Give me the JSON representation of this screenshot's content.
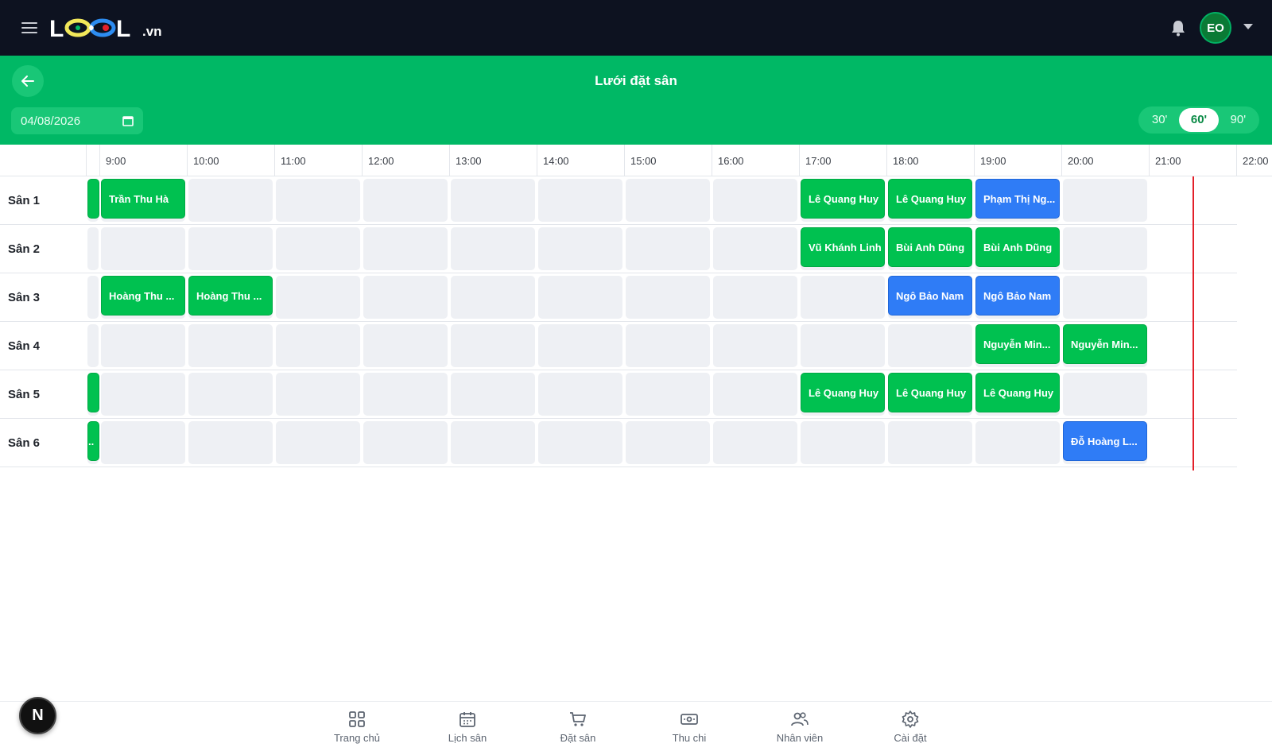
{
  "app": {
    "logo_text": "LOOL",
    "logo_suffix": ".vn",
    "user_initials": "EO",
    "page_title": "Lưới đặt sân",
    "date_value": "04/08/2026"
  },
  "colors": {
    "topbar": "#0d1220",
    "header_green": "#00b865",
    "booking_green": "#00c150",
    "booking_blue": "#2f7cf6",
    "now_line": "#e3202a"
  },
  "durations": [
    {
      "label": "30'",
      "active": false
    },
    {
      "label": "60'",
      "active": true
    },
    {
      "label": "90'",
      "active": false
    }
  ],
  "times": [
    "9:00",
    "10:00",
    "11:00",
    "12:00",
    "13:00",
    "14:00",
    "15:00",
    "16:00",
    "17:00",
    "18:00",
    "19:00",
    "20:00",
    "21:00",
    "22:00"
  ],
  "courts": [
    {
      "name": "Sân 1",
      "bookings": [
        {
          "slot": "8:00",
          "label": "",
          "color": "green",
          "partial": true
        },
        {
          "slot": "9:00",
          "label": "Trần Thu Hà",
          "color": "green"
        },
        {
          "slot": "17:00",
          "label": "Lê Quang Huy",
          "color": "green"
        },
        {
          "slot": "18:00",
          "label": "Lê Quang Huy",
          "color": "green"
        },
        {
          "slot": "19:00",
          "label": "Phạm Thị Ng...",
          "color": "blue"
        }
      ]
    },
    {
      "name": "Sân 2",
      "bookings": [
        {
          "slot": "17:00",
          "label": "Vũ Khánh Linh",
          "color": "green"
        },
        {
          "slot": "18:00",
          "label": "Bùi Anh Dũng",
          "color": "green"
        },
        {
          "slot": "19:00",
          "label": "Bùi Anh Dũng",
          "color": "green"
        }
      ]
    },
    {
      "name": "Sân 3",
      "bookings": [
        {
          "slot": "9:00",
          "label": "Hoàng Thu ...",
          "color": "green"
        },
        {
          "slot": "10:00",
          "label": "Hoàng Thu ...",
          "color": "green"
        },
        {
          "slot": "18:00",
          "label": "Ngô Bảo Nam",
          "color": "blue"
        },
        {
          "slot": "19:00",
          "label": "Ngô Bảo Nam",
          "color": "blue"
        }
      ]
    },
    {
      "name": "Sân 4",
      "bookings": [
        {
          "slot": "19:00",
          "label": "Nguyễn Min...",
          "color": "green"
        },
        {
          "slot": "20:00",
          "label": "Nguyễn Min...",
          "color": "green"
        }
      ]
    },
    {
      "name": "Sân 5",
      "bookings": [
        {
          "slot": "8:00",
          "label": "",
          "color": "green",
          "partial": true
        },
        {
          "slot": "17:00",
          "label": "Lê Quang Huy",
          "color": "green"
        },
        {
          "slot": "18:00",
          "label": "Lê Quang Huy",
          "color": "green"
        },
        {
          "slot": "19:00",
          "label": "Lê Quang Huy",
          "color": "green"
        }
      ]
    },
    {
      "name": "Sân 6",
      "bookings": [
        {
          "slot": "8:00",
          "label": "..",
          "color": "green",
          "partial": true
        },
        {
          "slot": "20:00",
          "label": "Đỗ Hoàng L...",
          "color": "blue"
        }
      ]
    }
  ],
  "bottom_nav": [
    {
      "label": "Trang chủ",
      "icon": "grid-icon"
    },
    {
      "label": "Lịch sân",
      "icon": "calendar-icon"
    },
    {
      "label": "Đặt sân",
      "icon": "cart-icon"
    },
    {
      "label": "Thu chi",
      "icon": "money-icon"
    },
    {
      "label": "Nhân viên",
      "icon": "users-icon"
    },
    {
      "label": "Cài đặt",
      "icon": "gear-icon"
    }
  ],
  "dev_badge": "N"
}
